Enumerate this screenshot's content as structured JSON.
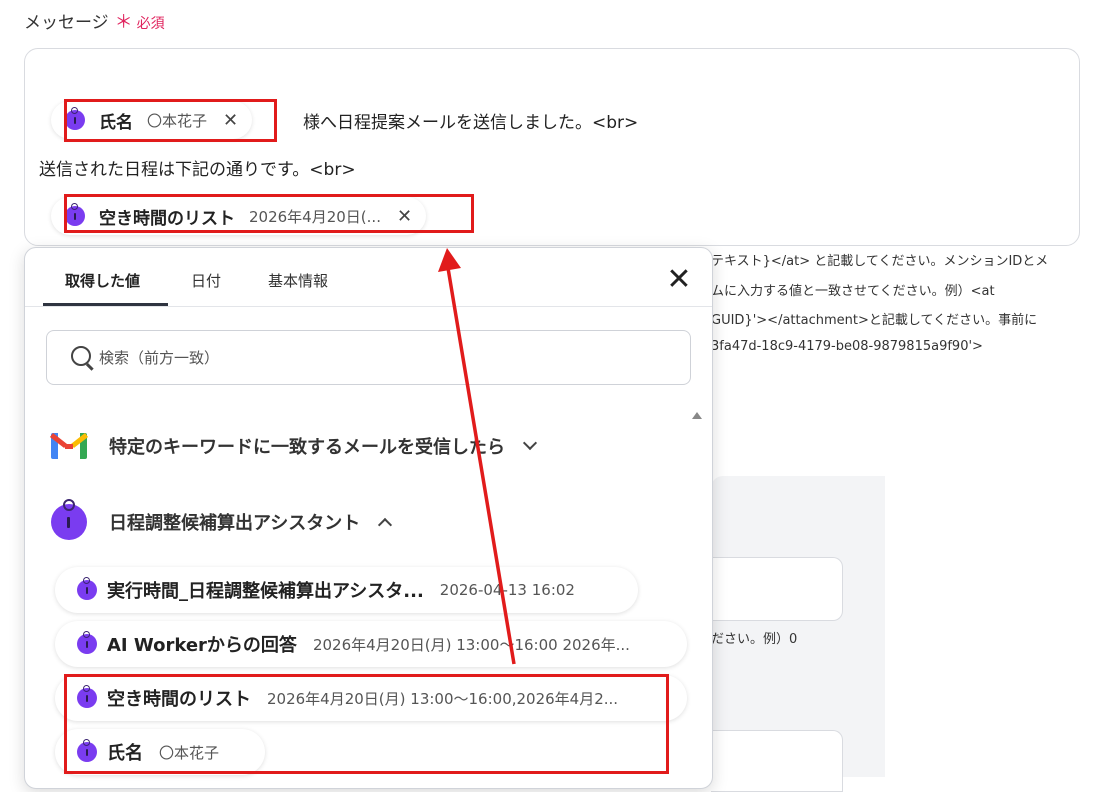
{
  "field": {
    "label": "メッセージ",
    "required_mark": "＊",
    "required_text": "必須"
  },
  "message": {
    "pill_name": {
      "name": "氏名",
      "value": "〇本花子",
      "remove": "✕"
    },
    "line1_text": "様へ日程提案メールを送信しました。<br>",
    "line2_text": "送信された日程は下記の通りです。<br>",
    "pill_slots": {
      "name": "空き時間のリスト",
      "value": "2026年4月20日(...",
      "remove": "✕"
    }
  },
  "help_text": {
    "line1": "テキスト}</at> と記載してください。メンションIDとメ",
    "line2": "ムに入力する値と一致させてください。例）<at",
    "line3": "GUID}'></attachment>と記載してください。事前に",
    "line4": "3fa47d-18c9-4179-be08-9879815a9f90'>",
    "note": "ださい。例）0"
  },
  "popup": {
    "tabs": [
      {
        "label": "取得した値",
        "active": true
      },
      {
        "label": "日付",
        "active": false
      },
      {
        "label": "基本情報",
        "active": false
      }
    ],
    "close": "✕",
    "search_placeholder": "検索（前方一致）",
    "sections": [
      {
        "title": "特定のキーワードに一致するメールを受信したら",
        "icon": "gmail-icon",
        "expanded": false
      },
      {
        "title": "日程調整候補算出アシスタント",
        "icon": "ai-worker-icon",
        "expanded": true
      }
    ],
    "items": [
      {
        "name": "実行時間_日程調整候補算出アシスタ...",
        "value": "2026-04-13 16:02"
      },
      {
        "name": "AI Workerからの回答",
        "value": "2026年4月20日(月) 13:00〜16:00 2026年..."
      },
      {
        "name": "空き時間のリスト",
        "value": "2026年4月20日(月) 13:00〜16:00,2026年4月2..."
      },
      {
        "name": "氏名",
        "value": "〇本花子"
      }
    ]
  },
  "colors": {
    "accent_purple": "#7a3cf0",
    "annotation_red": "#e11b1b",
    "required_pink": "#e0245e"
  }
}
